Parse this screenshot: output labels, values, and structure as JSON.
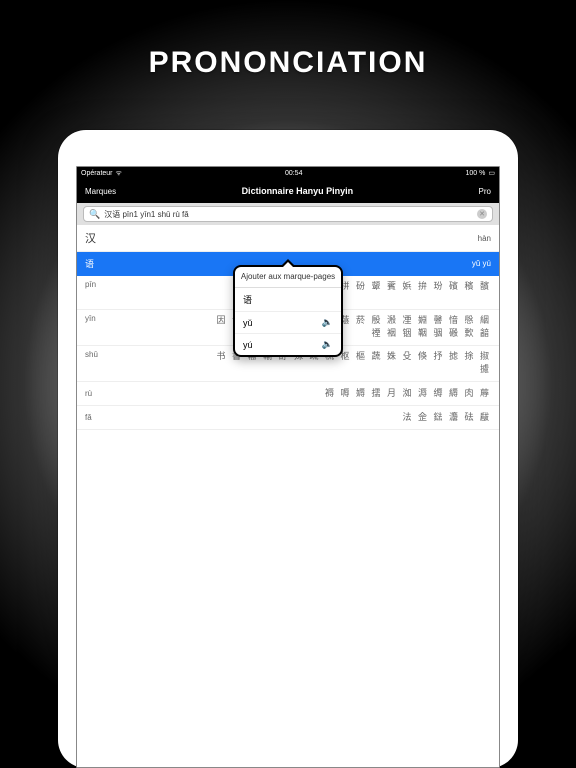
{
  "banner": "PRONONCIATION",
  "statusbar": {
    "carrier": "Opérateur",
    "wifi": "✦",
    "time": "00:54",
    "battery_pct": "100 %",
    "batt": "■"
  },
  "nav": {
    "left": "Marques",
    "title": "Dictionnaire Hanyu Pinyin",
    "right": "Pro"
  },
  "search": {
    "query": "汉语 pīn1 yīn1 shū rù fǎ"
  },
  "rows": {
    "header": {
      "han": "汉",
      "right": "hàn"
    },
    "selected": {
      "han": "语",
      "right": "yǔ yú"
    },
    "pin": {
      "pinyin": "pīn",
      "chars": "拼 砏 颦 薲 娦 拚 玢 礗 穦 馪"
    },
    "yin": {
      "pinyin": "yīn",
      "chars": "因 音 阴 陰 姻 烟 茵 荫 蔭 菸 殷\n溵 凐 婣 韾 愔 慇 絪 禋 裀 铟 鞇 骃 磤 歅 韽"
    },
    "shu": {
      "pinyin": "shū",
      "chars": "书 書 输 輸 舒 殊 疏 梳 枢 樞 蔬\n姝 殳 倏 抒 摅 捈 掓 攄"
    },
    "ru": {
      "pinyin": "rù",
      "chars": "褥 嗕 媷 擩 月 洳 溽 缛 縟 肉 蓐"
    },
    "fa": {
      "pinyin": "fǎ",
      "chars": "法 佱 鍅 灋 砝 瞂"
    }
  },
  "popover": {
    "header": "Ajouter aux\nmarque-pages",
    "items": [
      {
        "label": "语",
        "speaker": false
      },
      {
        "label": "yǔ",
        "speaker": true
      },
      {
        "label": "yú",
        "speaker": true
      }
    ]
  }
}
